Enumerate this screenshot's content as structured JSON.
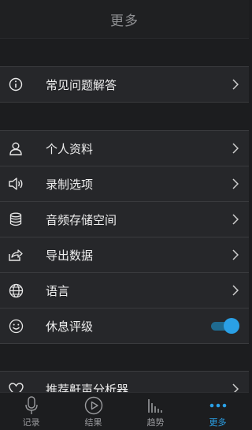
{
  "header": {
    "title": "更多"
  },
  "group_faq": [
    {
      "label": "常见问题解答",
      "icon": "info-icon"
    }
  ],
  "group_settings": [
    {
      "label": "个人资料",
      "icon": "person-icon"
    },
    {
      "label": "录制选项",
      "icon": "speaker-icon"
    },
    {
      "label": "音频存储空间",
      "icon": "database-icon"
    },
    {
      "label": "导出数据",
      "icon": "share-icon"
    },
    {
      "label": "语言",
      "icon": "globe-icon"
    },
    {
      "label": "休息评级",
      "icon": "smiley-icon",
      "toggle_on": true
    }
  ],
  "group_recommend": [
    {
      "label": "推荐鼾声分析器",
      "icon": "heart-icon"
    }
  ],
  "tabbar": [
    {
      "label": "记录",
      "icon": "microphone-icon",
      "active": false
    },
    {
      "label": "结果",
      "icon": "play-circle-icon",
      "active": false
    },
    {
      "label": "趋势",
      "icon": "bars-icon",
      "active": false
    },
    {
      "label": "更多",
      "icon": "more-dots-icon",
      "active": true
    }
  ],
  "colors": {
    "accent": "#2aa0e6",
    "background": "#1c1d1f",
    "row": "#26272a"
  }
}
